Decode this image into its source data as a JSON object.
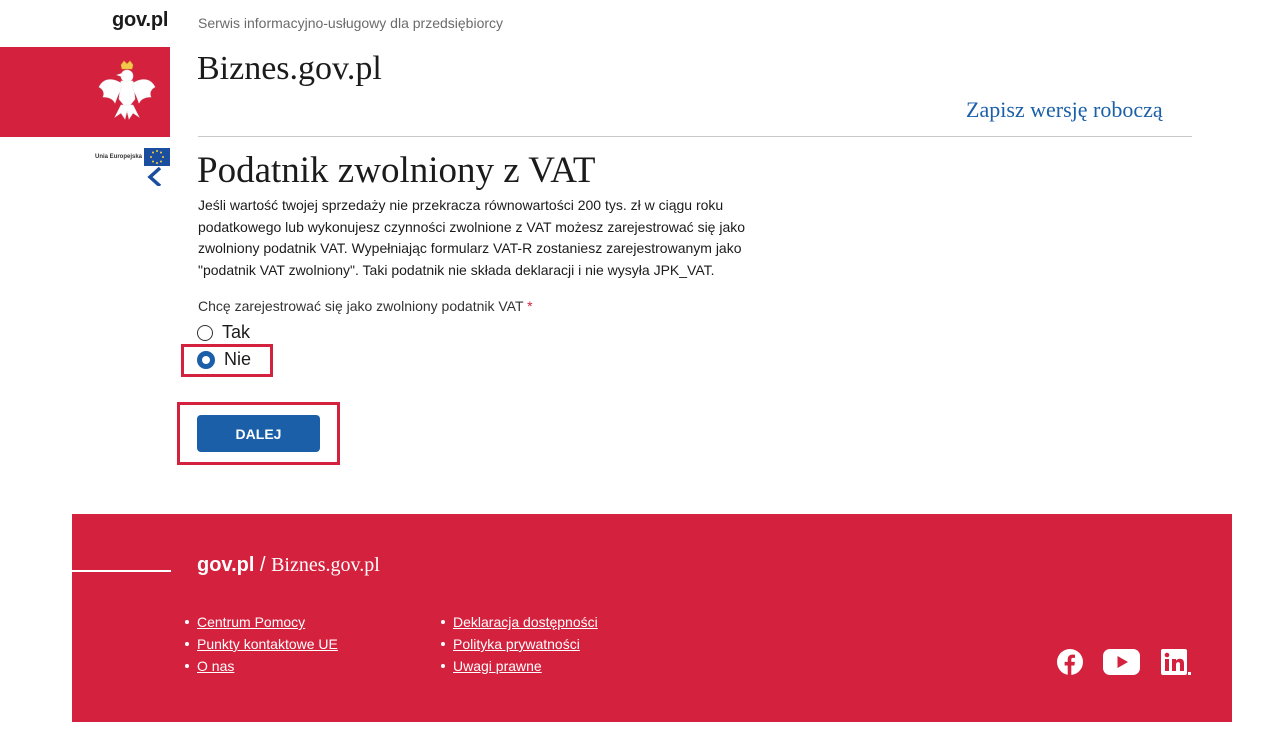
{
  "header": {
    "gov_logo": "gov.pl",
    "tagline": "Serwis informacyjno-usługowy dla przedsiębiorcy",
    "site_title": "Biznes.gov.pl",
    "save_draft": "Zapisz wersję roboczą",
    "eu_label": "Unia Europejska"
  },
  "form": {
    "heading": "Podatnik zwolniony z VAT",
    "description": "Jeśli wartość twojej sprzedaży nie przekracza równowartości 200 tys. zł w ciągu roku podatkowego lub wykonujesz czynności zwolnione z VAT możesz zarejestrować się jako zwolniony podatnik VAT. Wypełniając formularz VAT-R zostaniesz zarejestrowanym jako \"podatnik VAT zwolniony\". Taki podatnik nie składa deklaracji i nie wysyła JPK_VAT.",
    "question": "Chcę zarejestrować się jako zwolniony podatnik VAT",
    "required_mark": "*",
    "options": [
      {
        "label": "Tak",
        "selected": false
      },
      {
        "label": "Nie",
        "selected": true
      }
    ],
    "next_button": "DALEJ"
  },
  "footer": {
    "brand_gov": "gov.pl",
    "brand_sep": " / ",
    "brand_site": "Biznes.gov.pl",
    "links_col1": [
      "Centrum Pomocy",
      "Punkty kontaktowe UE",
      "O nas"
    ],
    "links_col2": [
      "Deklaracja dostępności",
      "Polityka prywatności",
      "Uwagi prawne"
    ],
    "social": [
      "facebook-icon",
      "youtube-icon",
      "linkedin-icon"
    ]
  },
  "colors": {
    "accent_red": "#d4213d",
    "primary_blue": "#1a5fa8"
  }
}
